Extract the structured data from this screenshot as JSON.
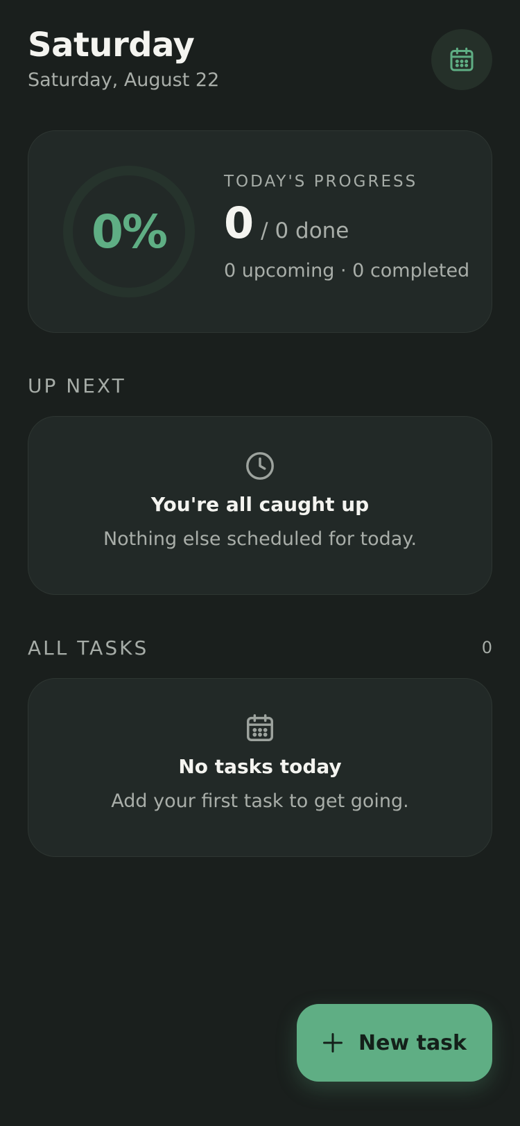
{
  "header": {
    "day_title": "Saturday",
    "date_subtitle": "Saturday, August 22"
  },
  "progress": {
    "percent_label": "0%",
    "percent_value": 0,
    "label": "TODAY'S PROGRESS",
    "done_count": "0",
    "done_suffix": "/ 0 done",
    "meta": "0 upcoming · 0 completed"
  },
  "up_next": {
    "section_label": "UP NEXT",
    "empty_icon": "clock-icon",
    "empty_title": "You're all caught up",
    "empty_desc": "Nothing else scheduled for today."
  },
  "all_tasks": {
    "section_label": "ALL TASKS",
    "count": "0",
    "empty_icon": "calendar-icon",
    "empty_title": "No tasks today",
    "empty_desc": "Add your first task to get going."
  },
  "fab": {
    "label": "New task",
    "icon": "plus-icon"
  },
  "colors": {
    "background": "#1a1f1d",
    "card": "#222927",
    "accent": "#5fae84",
    "muted_text": "#a9aea9"
  }
}
